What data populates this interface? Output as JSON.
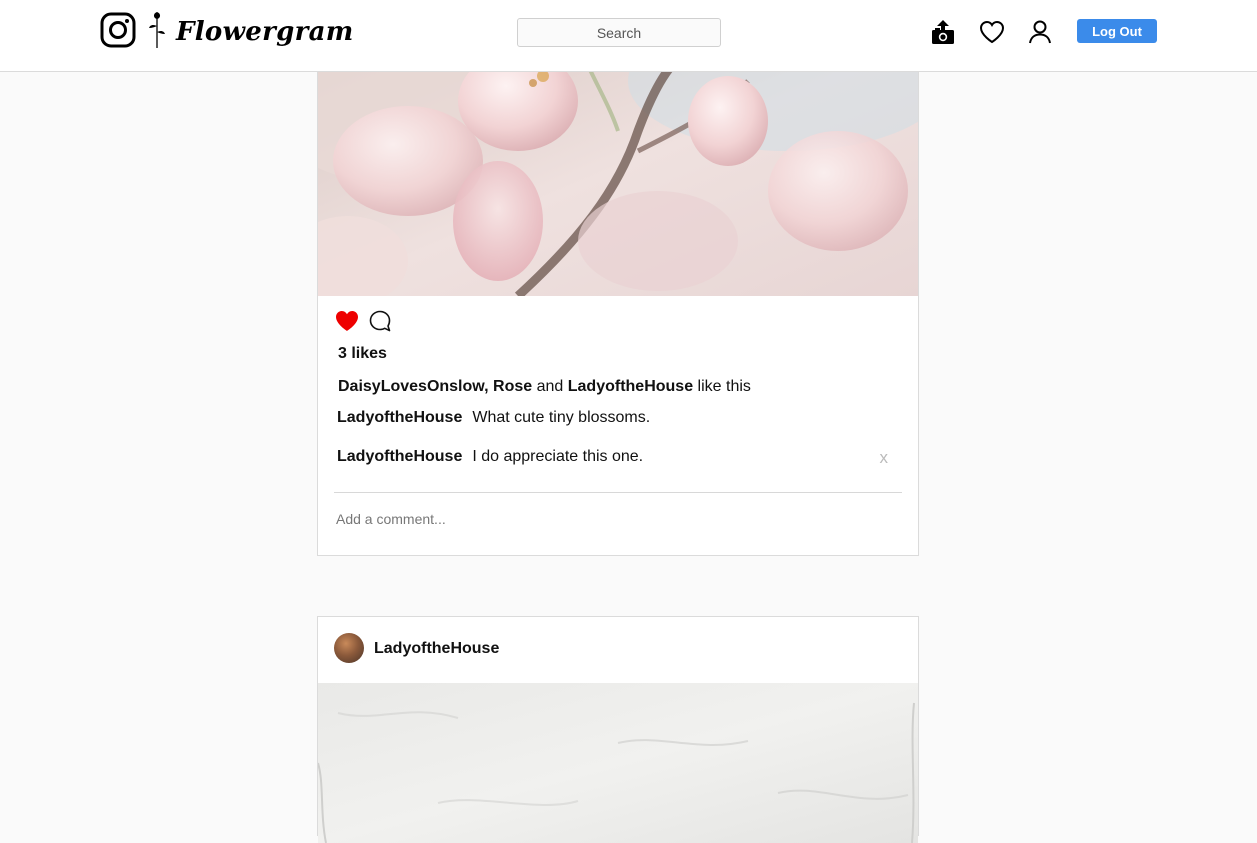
{
  "brand": {
    "name": "Flowergram"
  },
  "search": {
    "placeholder": "Search"
  },
  "header": {
    "logout_label": "Log Out"
  },
  "posts": [
    {
      "likes_text": "3 likes",
      "liked": true,
      "likers": [
        "DaisyLovesOnslow",
        "Rose",
        "LadyoftheHouse"
      ],
      "likers_connector": "and",
      "likers_suffix": "like this",
      "comments": [
        {
          "user": "LadyoftheHouse",
          "text": "What cute tiny blossoms.",
          "deletable": false
        },
        {
          "user": "LadyoftheHouse",
          "text": "I do appreciate this one.",
          "deletable": true,
          "delete_label": "x"
        }
      ],
      "add_comment_placeholder": "Add a comment..."
    },
    {
      "author": "LadyoftheHouse"
    }
  ],
  "colors": {
    "accent": "#3b8bea",
    "like": "#ee0000",
    "background": "#fafafa"
  }
}
